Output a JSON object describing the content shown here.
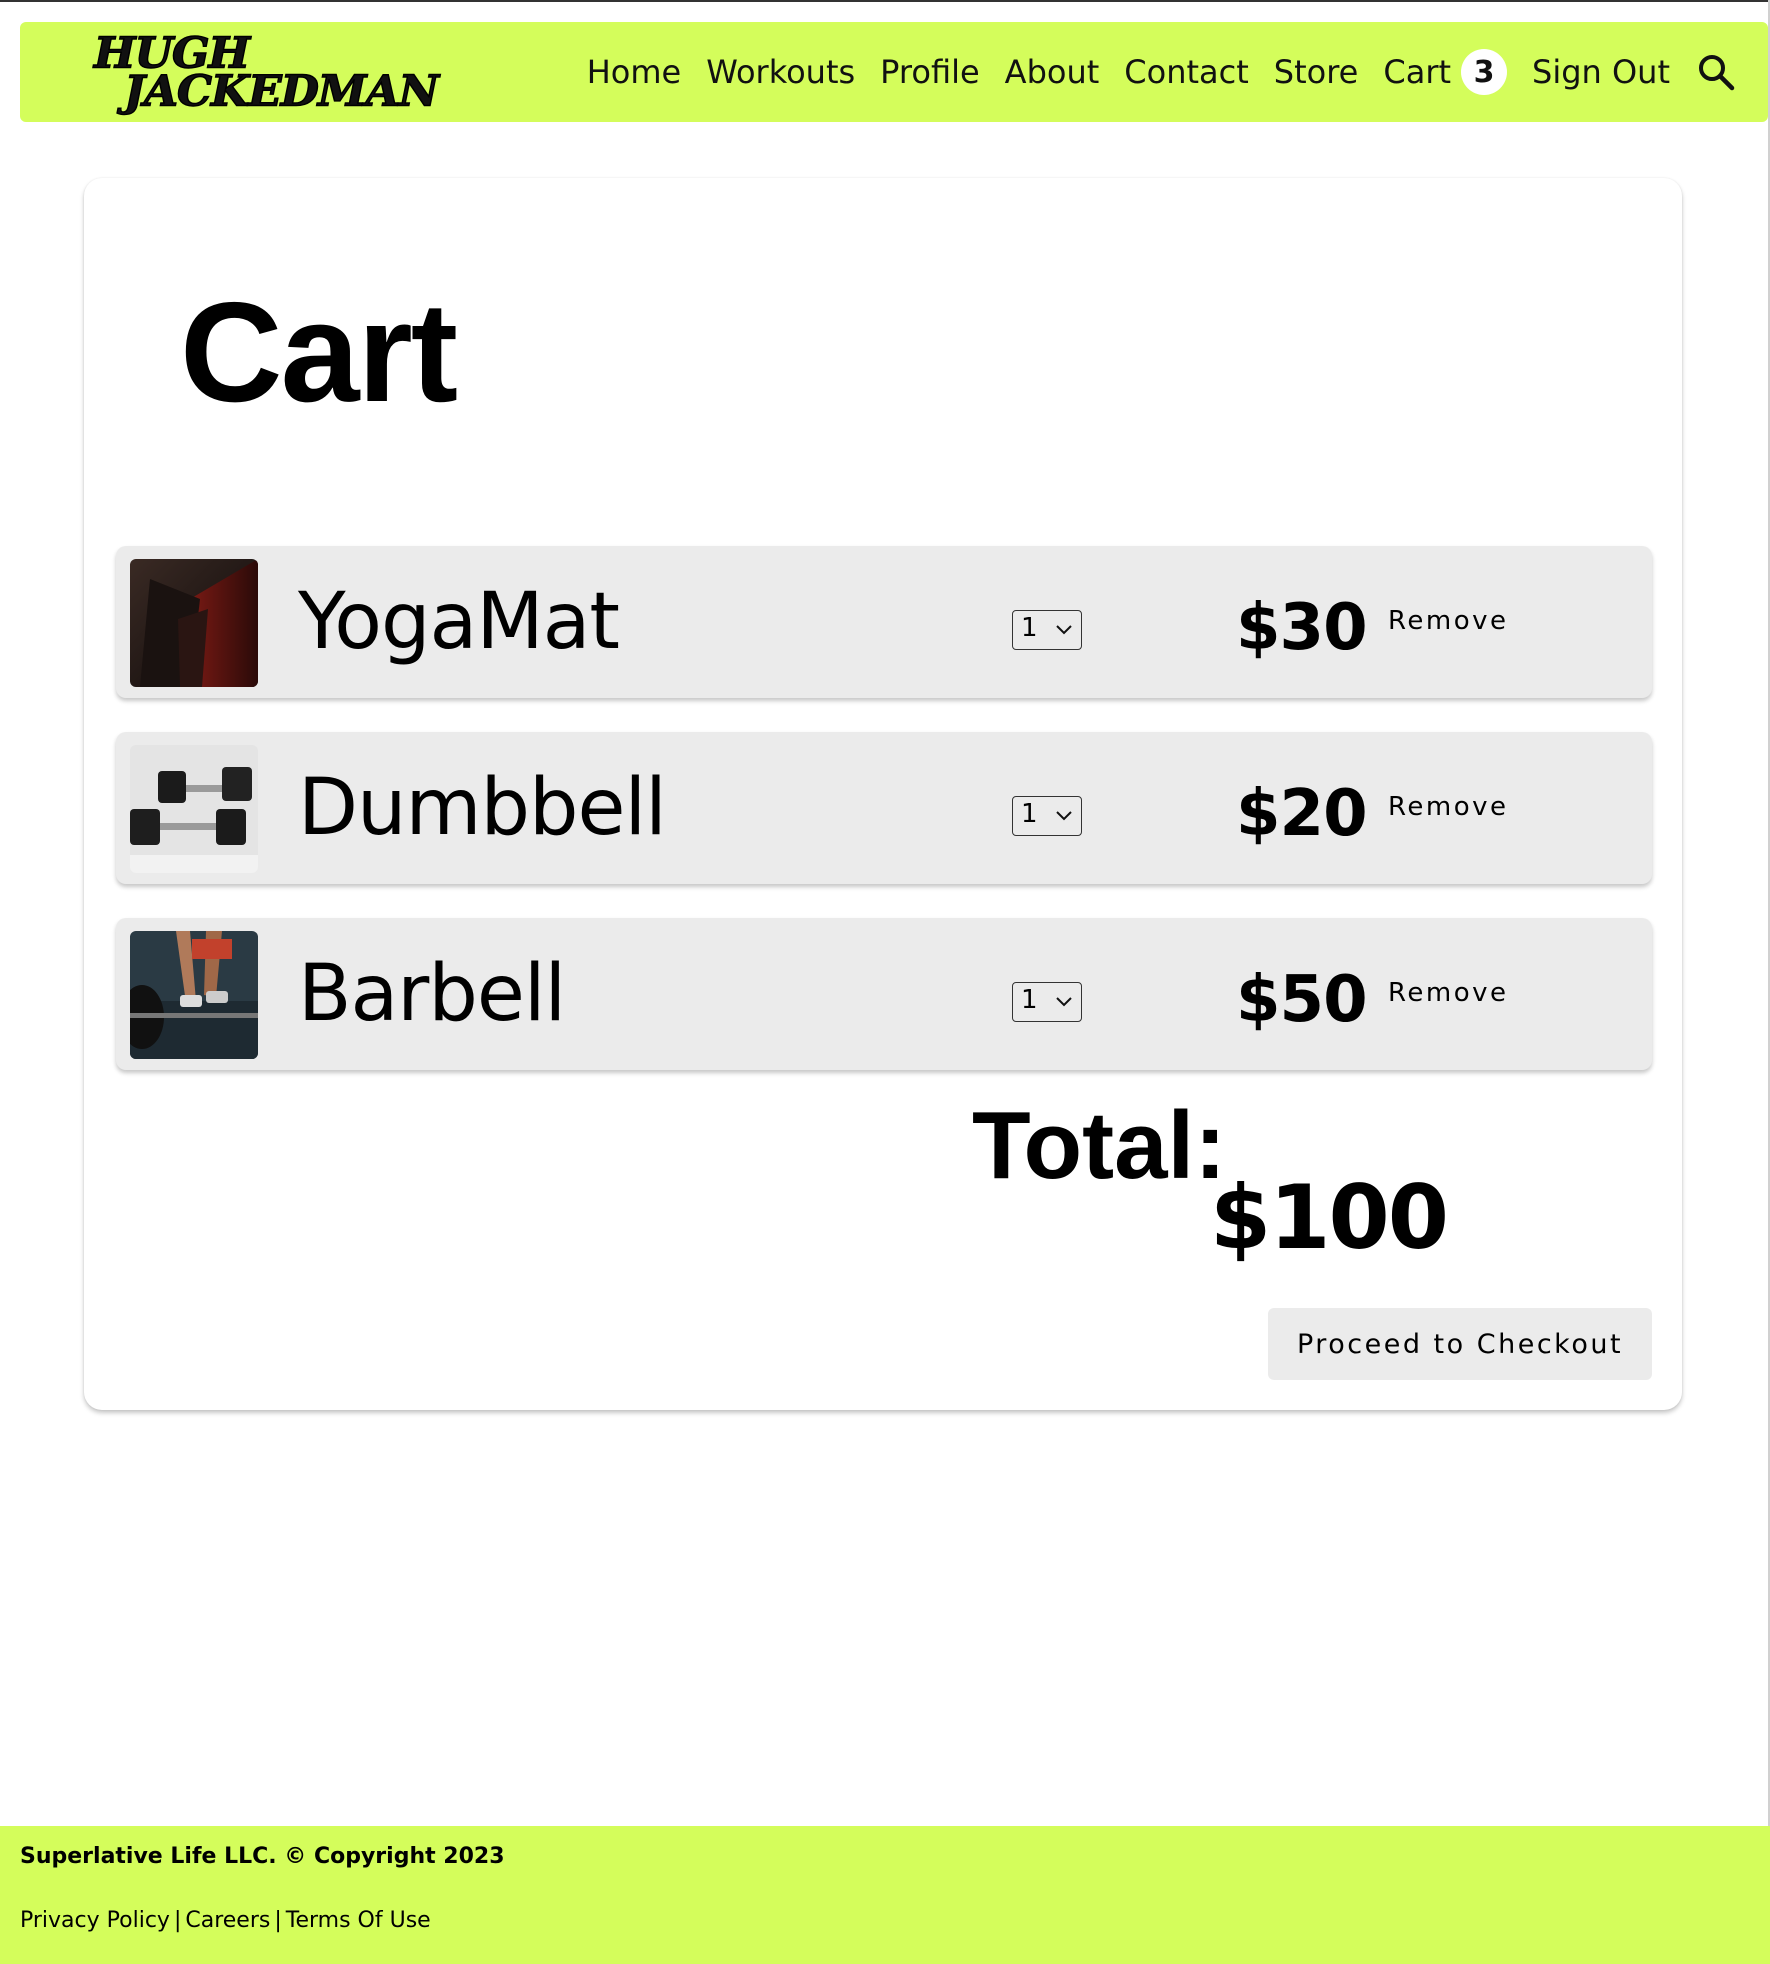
{
  "brand": {
    "logo_line1": "HUGH",
    "logo_line2": "JACKEDMAN",
    "accent_color": "#d4fd5b"
  },
  "nav": {
    "links": [
      {
        "label": "Home"
      },
      {
        "label": "Workouts"
      },
      {
        "label": "Profile"
      },
      {
        "label": "About"
      },
      {
        "label": "Contact"
      },
      {
        "label": "Store"
      }
    ],
    "cart_label": "Cart",
    "cart_count": "3",
    "signout_label": "Sign Out",
    "search_icon": "search-icon"
  },
  "cart": {
    "title": "Cart",
    "items": [
      {
        "name": "YogaMat",
        "quantity": "1",
        "price": "$30",
        "remove_label": "Remove",
        "image_icon": "yoga-mat-photo"
      },
      {
        "name": "Dumbbell",
        "quantity": "1",
        "price": "$20",
        "remove_label": "Remove",
        "image_icon": "dumbbell-photo"
      },
      {
        "name": "Barbell",
        "quantity": "1",
        "price": "$50",
        "remove_label": "Remove",
        "image_icon": "barbell-photo"
      }
    ],
    "total_label": "Total:",
    "total_value": "$100",
    "checkout_label": "Proceed to Checkout"
  },
  "footer": {
    "copyright": "Superlative Life LLC. © Copyright 2023",
    "links": [
      {
        "label": "Privacy Policy"
      },
      {
        "label": "Careers"
      },
      {
        "label": "Terms Of Use"
      }
    ],
    "separator": "|"
  }
}
